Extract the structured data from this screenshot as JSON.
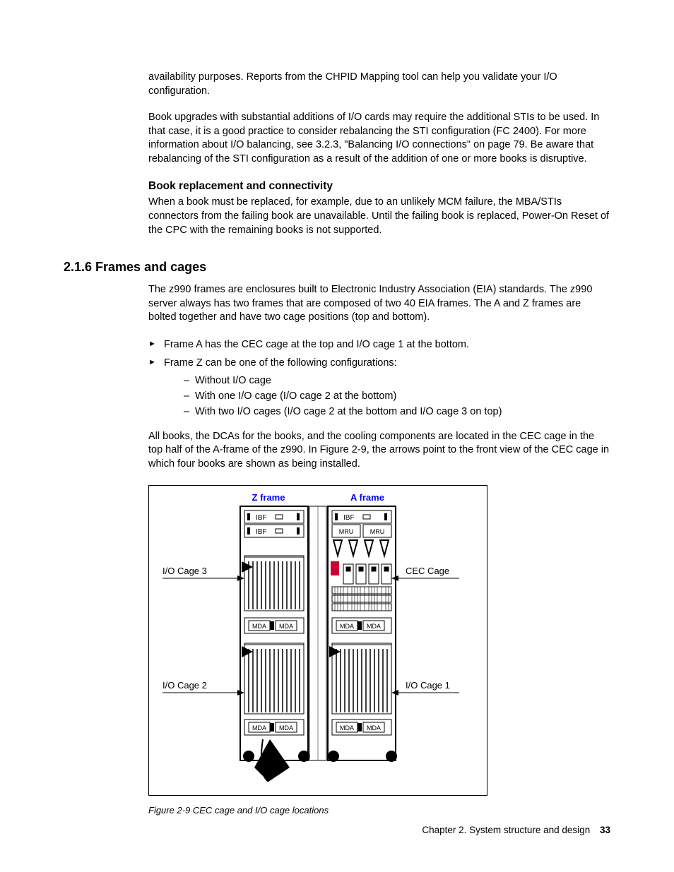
{
  "paragraphs": {
    "p1": "availability purposes. Reports from the CHPID Mapping tool can help you validate your I/O configuration.",
    "p2": "Book upgrades with substantial additions of I/O cards may require the additional STIs to be used. In that case, it is a good practice to consider rebalancing the STI configuration (FC 2400). For more information about I/O balancing, see 3.2.3, \"Balancing I/O connections\" on page 79. Be aware that rebalancing of the STI configuration as a result of the addition of one or more books is disruptive.",
    "h3": "Book replacement and connectivity",
    "p3": "When a book must be replaced, for example, due to an unlikely MCM failure, the MBA/STIs connectors from the failing book are unavailable. Until the failing book is replaced, Power-On Reset of the CPC with the remaining books is not supported.",
    "h2": "2.1.6  Frames and cages",
    "p4": "The z990 frames are enclosures built to Electronic Industry Association (EIA) standards. The z990 server always has two frames that are composed of two 40 EIA frames. The A and Z frames are bolted together and have two cage positions (top and bottom).",
    "b1": "Frame A has the CEC cage at the top and I/O cage 1 at the bottom.",
    "b2": "Frame Z can be one of the following configurations:",
    "d1": "Without I/O cage",
    "d2": "With one I/O cage (I/O cage 2 at the bottom)",
    "d3": "With two I/O cages (I/O cage 2 at the bottom and I/O cage 3 on top)",
    "p5": "All books, the DCAs for the books, and the cooling components are located in the CEC cage in the top half of the A-frame of the z990. In Figure 2-9, the arrows point to the front view of the CEC cage in which four books are shown as being installed."
  },
  "figure": {
    "zframe": "Z frame",
    "aframe": "A frame",
    "ibf": "IBF",
    "mru": "MRU",
    "mda": "MDA",
    "io3": "I/O Cage 3",
    "io2": "I/O Cage 2",
    "io1": "I/O Cage 1",
    "cec": "CEC Cage",
    "caption": "Figure 2-9   CEC cage and I/O cage locations"
  },
  "footer": {
    "chapter": "Chapter 2. System structure and design",
    "page": "33"
  }
}
